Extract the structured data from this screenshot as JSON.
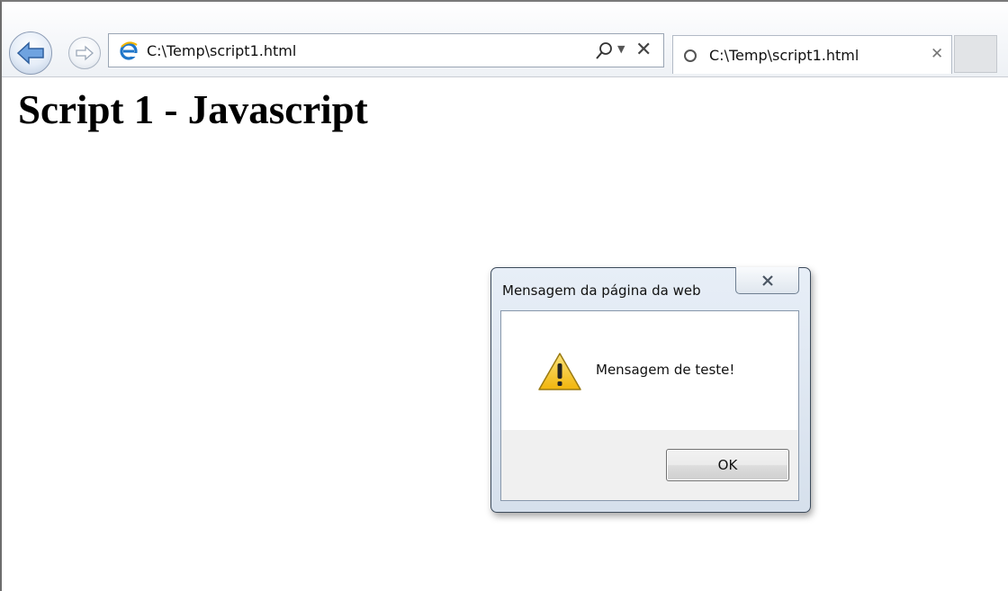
{
  "browser": {
    "address": "C:\\Temp\\script1.html",
    "tab_title": "C:\\Temp\\script1.html",
    "icons": {
      "back": "back-arrow-icon",
      "forward": "forward-arrow-icon",
      "site": "internet-explorer-icon",
      "search": "search-icon",
      "dropdown": "dropdown-icon",
      "stop": "stop-icon",
      "loading": "loading-icon",
      "tab_close": "close-icon"
    }
  },
  "page": {
    "heading": "Script 1 - Javascript"
  },
  "dialog": {
    "title": "Mensagem da página da web",
    "message": "Mensagem de teste!",
    "ok_label": "OK",
    "icon": "warning-icon"
  },
  "colors": {
    "warning_yellow": "#f4c41b",
    "ie_blue": "#1f76c9",
    "dialog_frame": "#d6e0ec"
  }
}
